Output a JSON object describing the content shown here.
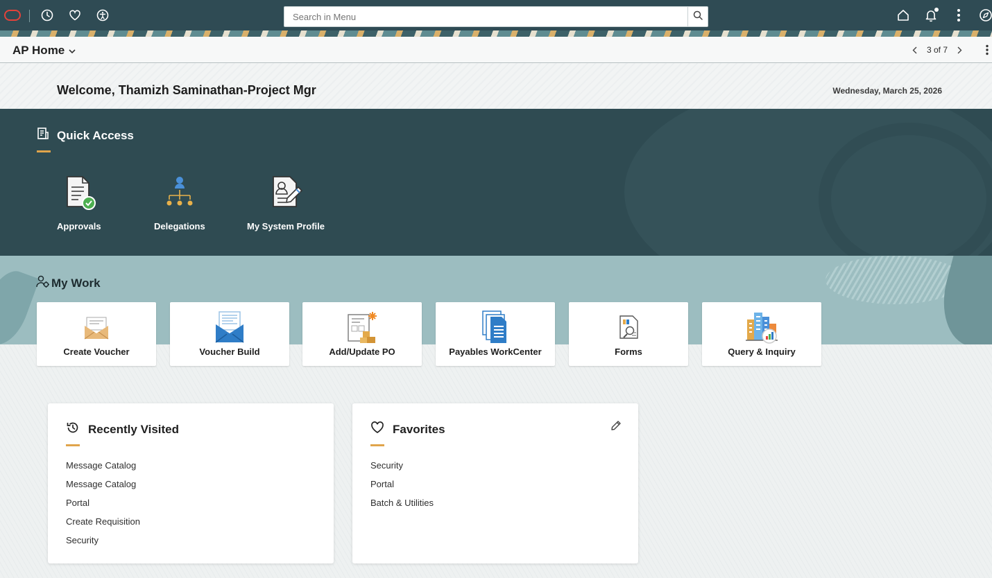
{
  "header": {
    "search_placeholder": "Search in Menu",
    "search_value": ""
  },
  "titlebar": {
    "title": "AP Home",
    "pager": "3 of 7"
  },
  "welcome": {
    "text": "Welcome, Thamizh Saminathan-Project Mgr",
    "date": "Wednesday, March 25, 2026"
  },
  "quick_access": {
    "title": "Quick Access",
    "tiles": [
      {
        "label": "Approvals"
      },
      {
        "label": "Delegations"
      },
      {
        "label": "My System Profile"
      }
    ]
  },
  "my_work": {
    "title": "My Work",
    "tiles": [
      {
        "label": "Create Voucher"
      },
      {
        "label": "Voucher Build"
      },
      {
        "label": "Add/Update PO"
      },
      {
        "label": "Payables WorkCenter"
      },
      {
        "label": "Forms"
      },
      {
        "label": "Query & Inquiry"
      }
    ]
  },
  "recently_visited": {
    "title": "Recently Visited",
    "items": [
      "Message Catalog",
      "Message Catalog",
      "Portal",
      "Create Requisition",
      "Security"
    ]
  },
  "favorites": {
    "title": "Favorites",
    "items": [
      "Security",
      "Portal",
      "Batch & Utilities"
    ]
  },
  "colors": {
    "header_bg": "#2f4b54",
    "quick_access_bg": "#2f4b52",
    "my_work_bg": "#9cbdc0",
    "accent": "#e0a44b",
    "oracle_red": "#e5423a"
  }
}
